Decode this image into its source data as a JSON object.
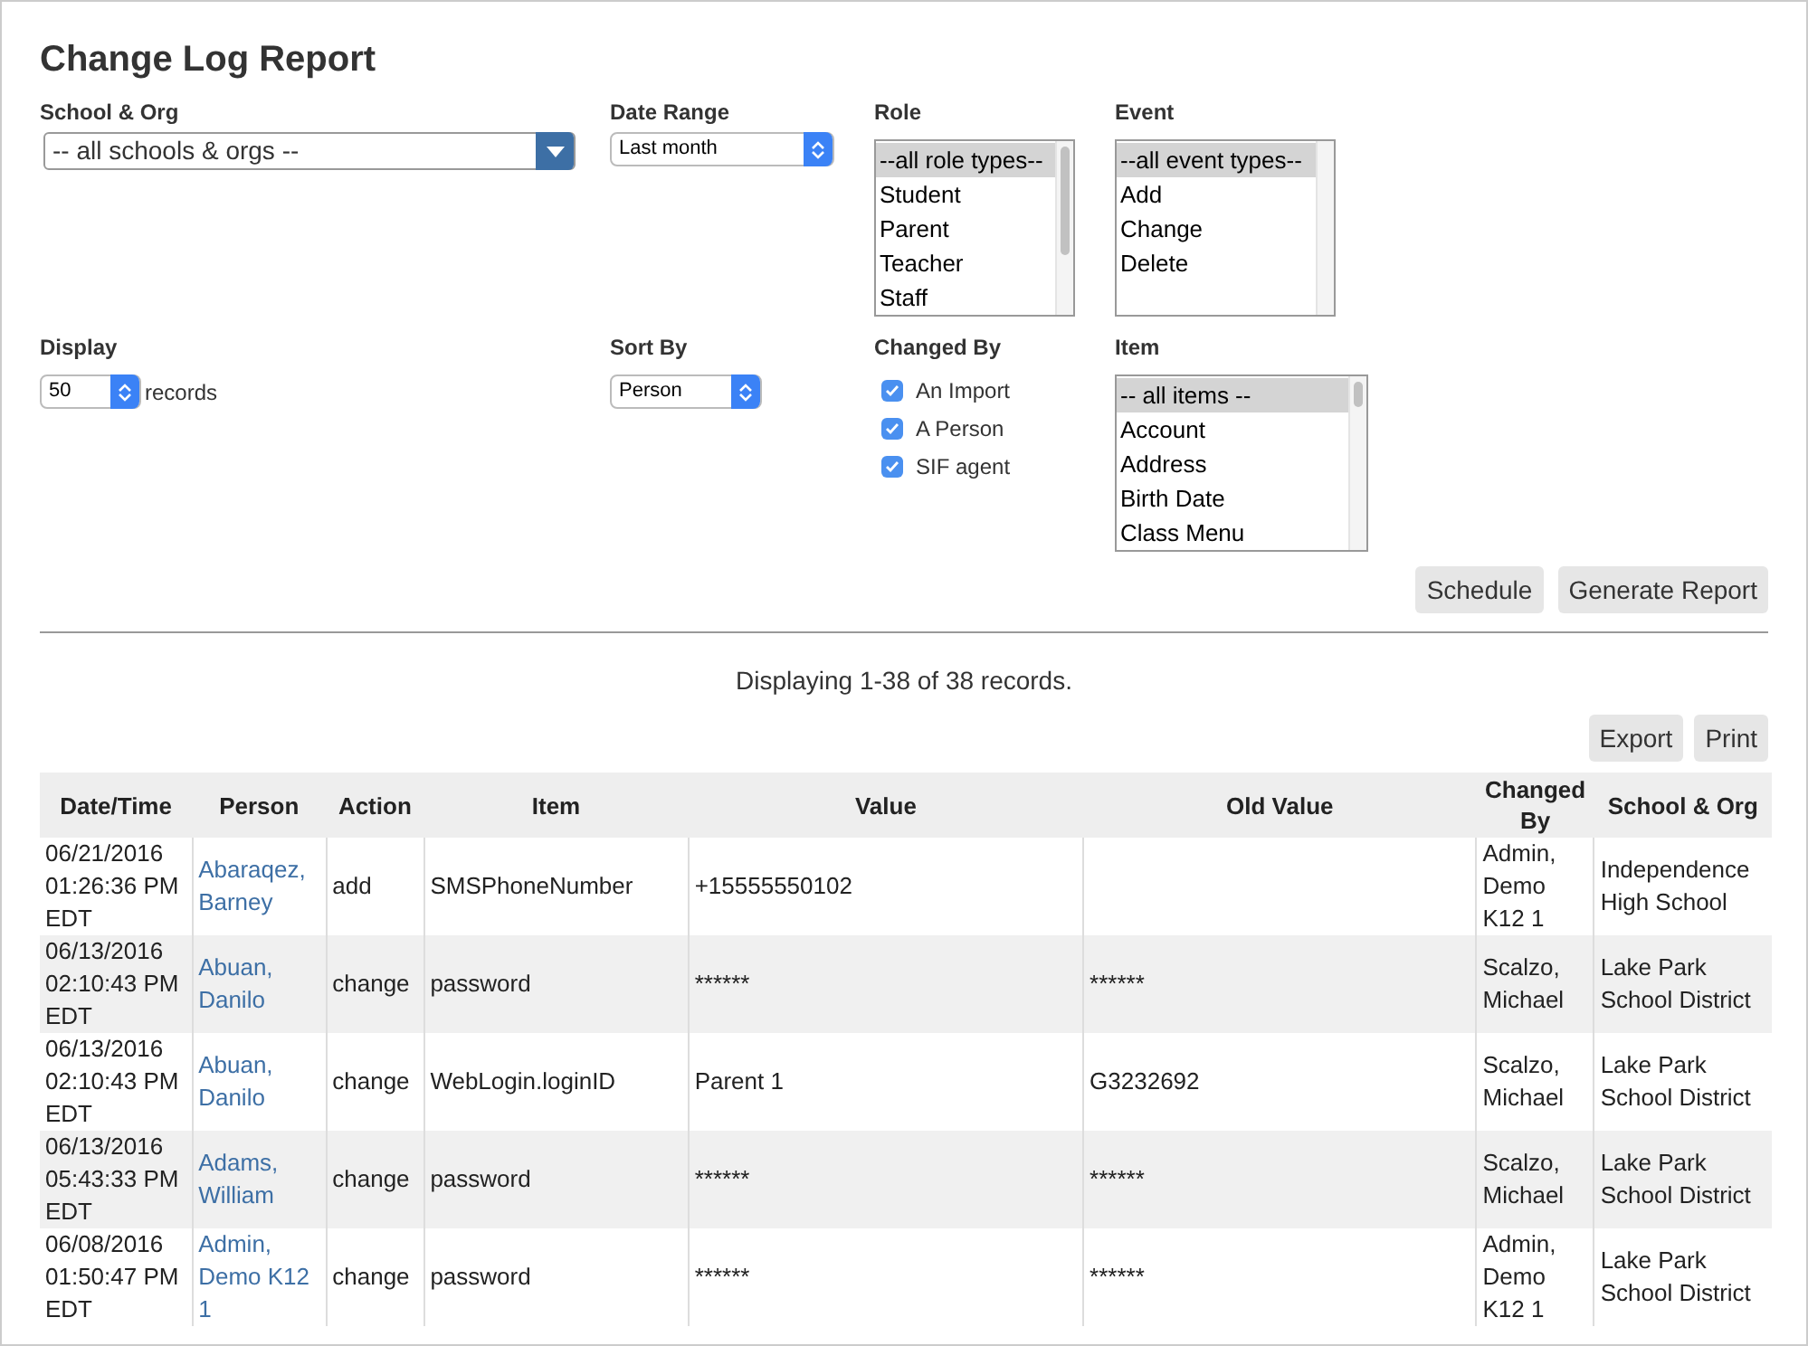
{
  "title": "Change Log Report",
  "filters": {
    "school_org": {
      "label": "School & Org",
      "value": "-- all schools & orgs --"
    },
    "date_range": {
      "label": "Date Range",
      "value": "Last month"
    },
    "role": {
      "label": "Role",
      "options": [
        {
          "label": "--all role types--",
          "selected": true
        },
        {
          "label": "Student",
          "selected": false
        },
        {
          "label": "Parent",
          "selected": false
        },
        {
          "label": "Teacher",
          "selected": false
        },
        {
          "label": "Staff",
          "selected": false
        }
      ]
    },
    "event": {
      "label": "Event",
      "options": [
        {
          "label": "--all event types--",
          "selected": true
        },
        {
          "label": "Add",
          "selected": false
        },
        {
          "label": "Change",
          "selected": false
        },
        {
          "label": "Delete",
          "selected": false
        }
      ]
    },
    "display": {
      "label": "Display",
      "value": "50",
      "suffix": "records"
    },
    "sort_by": {
      "label": "Sort By",
      "value": "Person"
    },
    "changed_by": {
      "label": "Changed By",
      "options": [
        {
          "label": "An Import",
          "checked": true
        },
        {
          "label": "A Person",
          "checked": true
        },
        {
          "label": "SIF agent",
          "checked": true
        }
      ]
    },
    "item": {
      "label": "Item",
      "options": [
        {
          "label": "-- all items --",
          "selected": true
        },
        {
          "label": "Account",
          "selected": false
        },
        {
          "label": "Address",
          "selected": false
        },
        {
          "label": "Birth Date",
          "selected": false
        },
        {
          "label": "Class Menu",
          "selected": false
        }
      ]
    }
  },
  "actions": [
    "Schedule",
    "Generate Report"
  ],
  "summary": "Displaying 1-38 of 38 records.",
  "table_actions": [
    "Export",
    "Print"
  ],
  "table": {
    "columns": [
      "Date/Time",
      "Person",
      "Action",
      "Item",
      "Value",
      "Old Value",
      "Changed By",
      "School & Org"
    ],
    "rows": [
      [
        "06/21/2016 01:26:36 PM EDT",
        "Abaraqez, Barney",
        "add",
        "SMSPhoneNumber",
        "+15555550102",
        "",
        "Admin, Demo K12 1",
        "Independence High School"
      ],
      [
        "06/13/2016 02:10:43 PM EDT",
        "Abuan, Danilo",
        "change",
        "password",
        "******",
        "******",
        "Scalzo, Michael",
        "Lake Park School District"
      ],
      [
        "06/13/2016 02:10:43 PM EDT",
        "Abuan, Danilo",
        "change",
        "WebLogin.loginID",
        "Parent 1",
        "G3232692",
        "Scalzo, Michael",
        "Lake Park School District"
      ],
      [
        "06/13/2016 05:43:33 PM EDT",
        "Adams, William",
        "change",
        "password",
        "******",
        "******",
        "Scalzo, Michael",
        "Lake Park School District"
      ],
      [
        "06/08/2016 01:50:47 PM EDT",
        "Admin, Demo K12 1",
        "change",
        "password",
        "******",
        "******",
        "Admin, Demo K12 1",
        "Lake Park School District"
      ]
    ]
  }
}
